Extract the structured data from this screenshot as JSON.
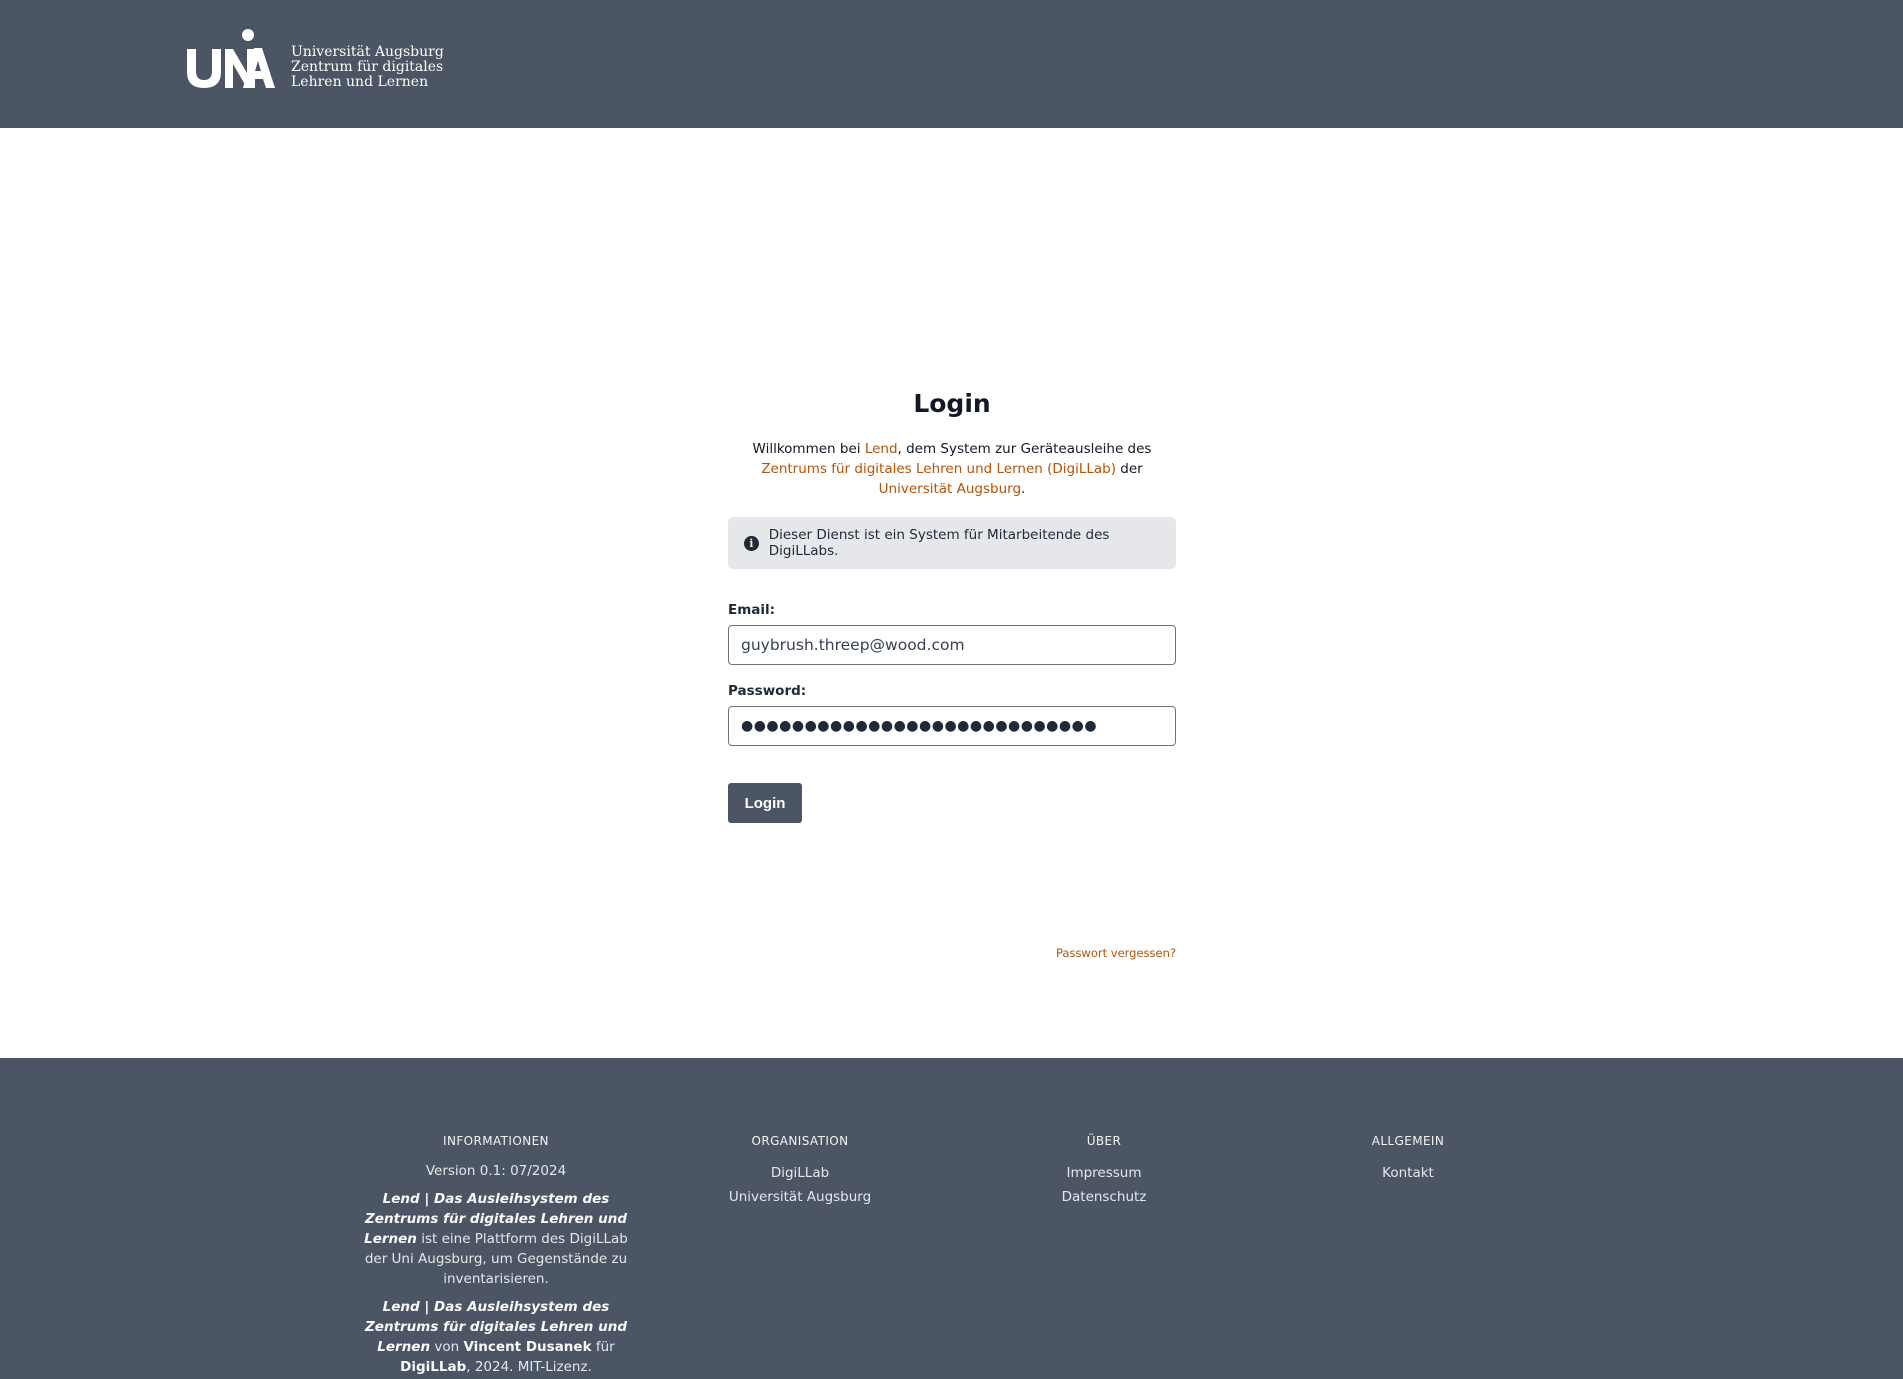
{
  "header": {
    "logo_lines": [
      "Universität Augsburg",
      "Zentrum für digitales",
      "Lehren und Lernen"
    ]
  },
  "login": {
    "title": "Login",
    "welcome": {
      "p1": "Willkommen bei ",
      "link_lend": "Lend",
      "p2": ", dem System zur Geräteausleihe des ",
      "link_zentrum": "Zentrums für digitales Lehren und Lernen (DigiLLab)",
      "p3": " der ",
      "link_uni": "Universität Augsburg",
      "p4": "."
    },
    "notice": "Dieser Dienst ist ein System für Mitarbeitende des DigiLLabs.",
    "email_label": "Email:",
    "email_value": "guybrush.threep@wood.com",
    "password_label": "Password:",
    "password_value": "●●●●●●●●●●●●●●●●●●●●●●●●●●●●",
    "login_button": "Login",
    "forgot_link": "Passwort vergessen?"
  },
  "footer": {
    "informationen": {
      "heading": "INFORMATIONEN",
      "version": "Version 0.1: 07/2024",
      "para1_bold": "Lend | Das Ausleihsystem des Zentrums für digitales Lehren und Lernen",
      "para1_rest": " ist eine Plattform des DigiLLab der Uni Augsburg, um Gegenstände zu inventarisieren.",
      "para2_bold": "Lend | Das Ausleihsystem des Zentrums für digitales Lehren und Lernen",
      "para2_von": " von ",
      "para2_author": "Vincent Dusanek",
      "para2_fuer": " für ",
      "para2_org": "DigiLLab",
      "para2_end": ", 2024. MIT-Lizenz."
    },
    "organisation": {
      "heading": "ORGANISATION",
      "items": [
        "DigiLLab",
        "Universität Augsburg"
      ]
    },
    "ueber": {
      "heading": "ÜBER",
      "items": [
        "Impressum",
        "Datenschutz"
      ]
    },
    "allgemein": {
      "heading": "ALLGEMEIN",
      "items": [
        "Kontakt"
      ]
    }
  },
  "colors": {
    "header_bg": "#4b5563",
    "link_accent": "#b45309",
    "notice_bg": "#e5e7eb",
    "button_bg": "#4b5563"
  }
}
